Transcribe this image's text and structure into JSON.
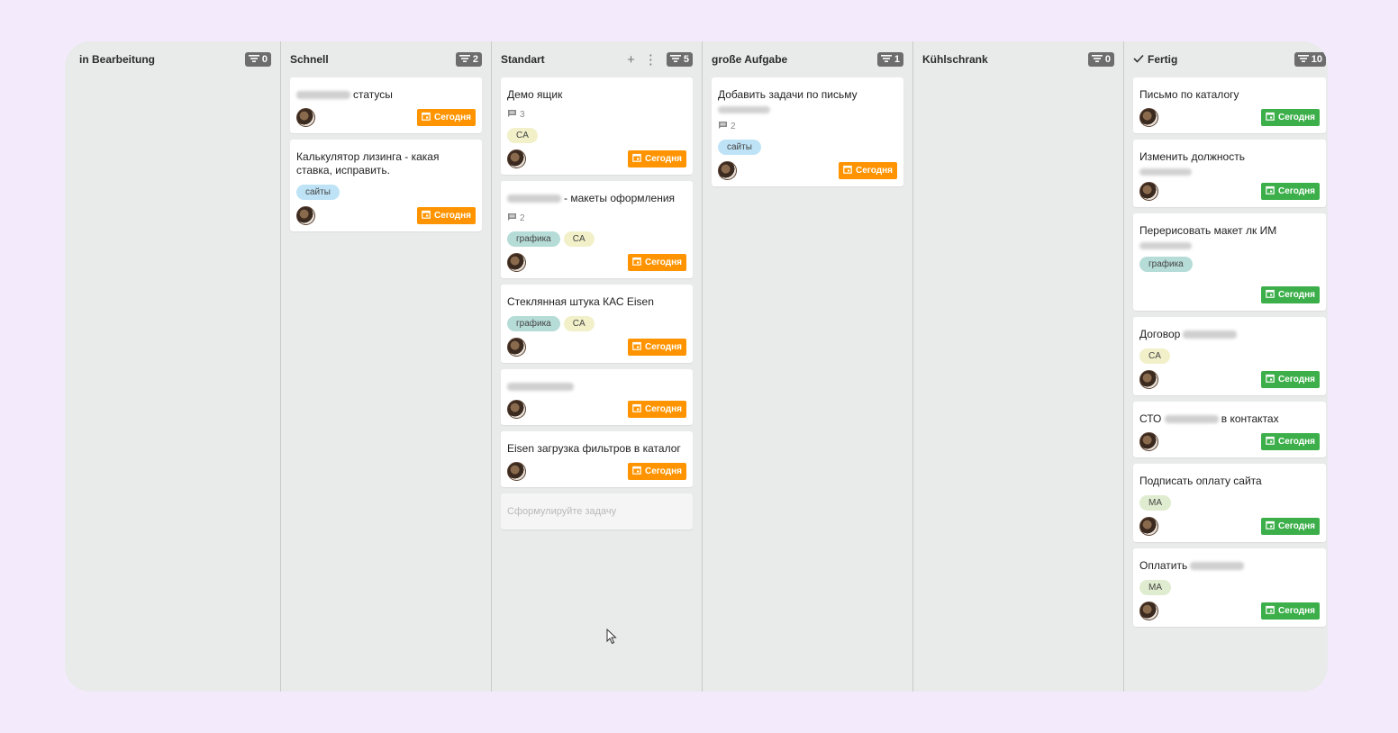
{
  "labels": {
    "today": "Сегодня",
    "new_task_placeholder": "Сформулируйте задачу"
  },
  "colors": {
    "date_orange": "#ff9400",
    "date_green": "#3caf4a",
    "tag_sites": "#bfe3f6",
    "tag_graphics": "#b6dcd8",
    "tag_ca": "#f1f0c9",
    "tag_ma": "#e0eccf"
  },
  "columns": [
    {
      "title": "in Bearbeitung",
      "count": "0",
      "checked": false,
      "cards": []
    },
    {
      "title": "Schnell",
      "count": "2",
      "checked": false,
      "cards": [
        {
          "title": "статусы",
          "blur_prefix": true,
          "comments": "",
          "tags": [],
          "date": "Сегодня",
          "date_color": "orange"
        },
        {
          "title": "Калькулятор лизинга - какая ставка, исправить.",
          "comments": "",
          "tags": [
            "сайты"
          ],
          "date": "Сегодня",
          "date_color": "orange"
        }
      ]
    },
    {
      "title": "Standart",
      "count": "5",
      "checked": false,
      "actions": [
        "+",
        "⋮"
      ],
      "cards": [
        {
          "title": "Демо ящик",
          "comments": "3",
          "tags": [
            "CA"
          ],
          "date": "Сегодня",
          "date_color": "orange"
        },
        {
          "title": "- макеты оформления",
          "blur_prefix": true,
          "comments": "2",
          "tags": [
            "графика",
            "CA"
          ],
          "date": "Сегодня",
          "date_color": "orange"
        },
        {
          "title": "Стеклянная штука КАС Eisen",
          "comments": "",
          "tags": [
            "графика",
            "CA"
          ],
          "date": "Сегодня",
          "date_color": "orange"
        },
        {
          "title": "",
          "blur_prefix": true,
          "comments": "",
          "tags": [],
          "date": "Сегодня",
          "date_color": "orange"
        },
        {
          "title": "Eisen загрузка фильтров в каталог",
          "comments": "",
          "tags": [],
          "date": "Сегодня",
          "date_color": "orange"
        }
      ]
    },
    {
      "title": "große Aufgabe",
      "count": "1",
      "checked": false,
      "cards": [
        {
          "title": "Добавить задачи по письму",
          "blur_line": true,
          "comments": "2",
          "tags": [
            "сайты"
          ],
          "date": "Сегодня",
          "date_color": "orange"
        }
      ]
    },
    {
      "title": "Kühlschrank",
      "count": "0",
      "checked": false,
      "cards": []
    },
    {
      "title": "Fertig",
      "count": "10",
      "checked": true,
      "cards": [
        {
          "title": "Письмо по каталогу",
          "comments": "",
          "tags": [],
          "date": "Сегодня",
          "date_color": "green"
        },
        {
          "title": "Изменить должность",
          "blur_line": true,
          "comments": "",
          "tags": [],
          "date": "Сегодня",
          "date_color": "green"
        },
        {
          "title": "Перерисовать макет лк ИМ",
          "blur_line": true,
          "comments": "",
          "tags": [
            "графика"
          ],
          "date": "Сегодня",
          "date_color": "green",
          "extra_gap": true
        },
        {
          "title": "Договор",
          "blur_suffix": true,
          "comments": "",
          "tags": [
            "CA"
          ],
          "date": "Сегодня",
          "date_color": "green"
        },
        {
          "title": "в контактах",
          "title_prefix": "СТО",
          "blur_middle": true,
          "comments": "",
          "tags": [],
          "date": "Сегодня",
          "date_color": "green"
        },
        {
          "title": "Подписать оплату сайта",
          "comments": "",
          "tags": [
            "MA"
          ],
          "date": "Сегодня",
          "date_color": "green"
        },
        {
          "title": "Оплатить",
          "blur_suffix": true,
          "comments": "",
          "tags": [
            "MA"
          ],
          "date": "Сегодня",
          "date_color": "green"
        }
      ]
    }
  ]
}
